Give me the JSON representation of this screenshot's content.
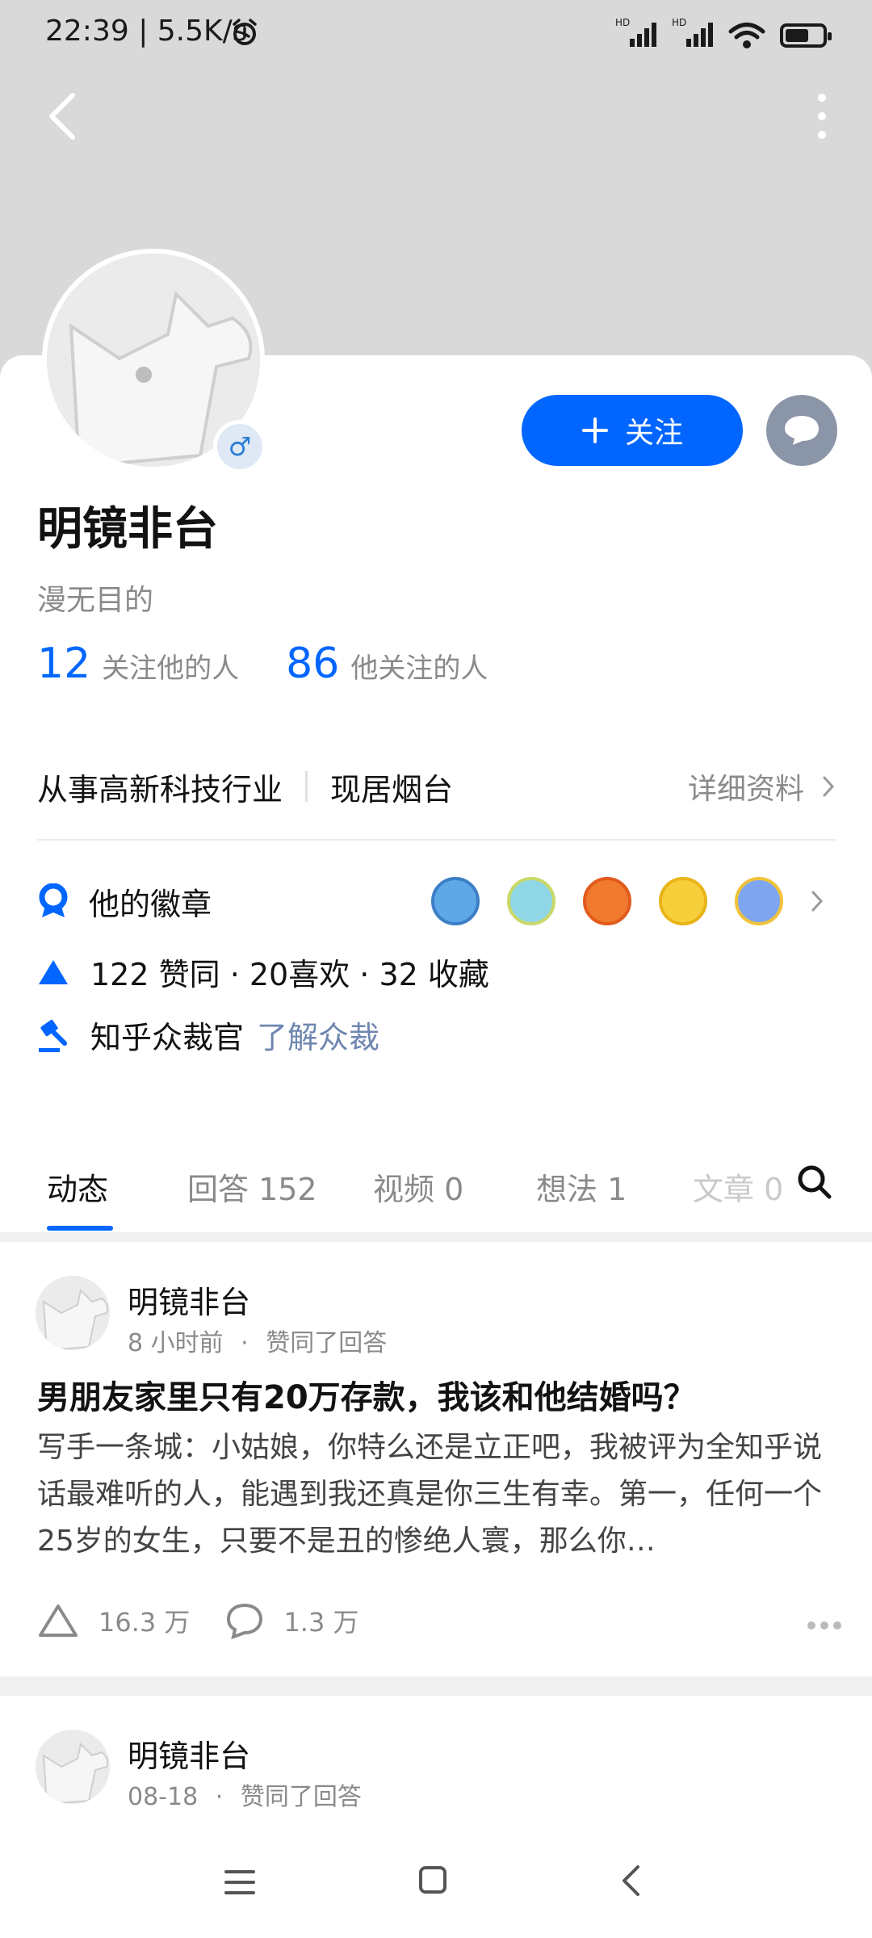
{
  "status_bar": {
    "time_speed": "22:39 | 5.5K/s",
    "sig1": "HD",
    "sig2": "HD"
  },
  "profile": {
    "name": "明镜非台",
    "gender_symbol": "♂",
    "headline": "漫无目的",
    "followers_count": "12",
    "followers_label": "关注他的人",
    "following_count": "86",
    "following_label": "他关注的人",
    "industry": "从事高新科技行业",
    "location": "现居烟台",
    "detail_link": "详细资料",
    "badges_label": "他的徽章",
    "stats_line": "122 赞同 · 20喜欢 · 32 收藏",
    "moderator_label": "知乎众裁官",
    "moderator_link": "了解众裁",
    "follow_button": "关注"
  },
  "tabs": [
    {
      "label": "动态"
    },
    {
      "label": "回答 152"
    },
    {
      "label": "视频 0"
    },
    {
      "label": "想法 1"
    },
    {
      "label": "文章 0"
    }
  ],
  "feed": [
    {
      "author": "明镜非台",
      "time": "8 小时前",
      "action": "赞同了回答",
      "title": "男朋友家里只有20万存款，我该和他结婚吗？",
      "excerpt": "写手一条城：小姑娘，你特么还是立正吧，我被评为全知乎说话最难听的人，能遇到我还真是你三生有幸。第一，任何一个25岁的女生，只要不是丑的惨绝人寰，那么你…",
      "upvotes": "16.3 万",
      "comments": "1.3 万"
    },
    {
      "author": "明镜非台",
      "time": "08-18",
      "action": "赞同了回答"
    }
  ],
  "colors": {
    "accent": "#0066ff",
    "header_bg": "#d9d9d9"
  }
}
